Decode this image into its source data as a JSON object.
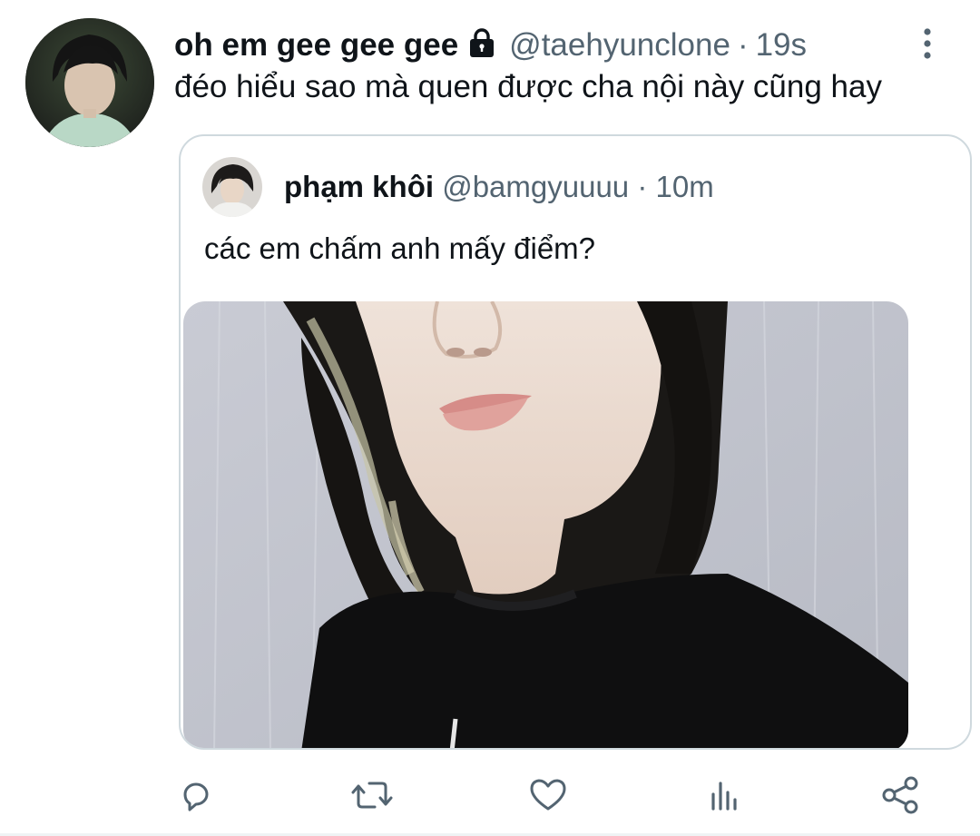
{
  "tweet": {
    "display_name": "oh em gee gee gee",
    "handle": "@taehyunclone",
    "separator": "·",
    "time": "19s",
    "text": "đéo hiểu sao mà quen được cha nội này cũng hay",
    "protected_icon": "lock-icon",
    "more_icon": "more-vertical-icon"
  },
  "quoted_tweet": {
    "display_name": "phạm khôi",
    "handle": "@bamgyuuuu",
    "separator": "·",
    "time": "10m",
    "text": "các em chấm anh mấy điểm?",
    "media": "photo-of-person-closeup"
  },
  "actions": {
    "reply_icon": "reply-icon",
    "retweet_icon": "retweet-icon",
    "like_icon": "heart-icon",
    "analytics_icon": "analytics-icon",
    "share_icon": "share-icon"
  },
  "colors": {
    "text_primary": "#0f1419",
    "text_secondary": "#536471",
    "border": "#cfd9de",
    "icon": "#536471"
  }
}
